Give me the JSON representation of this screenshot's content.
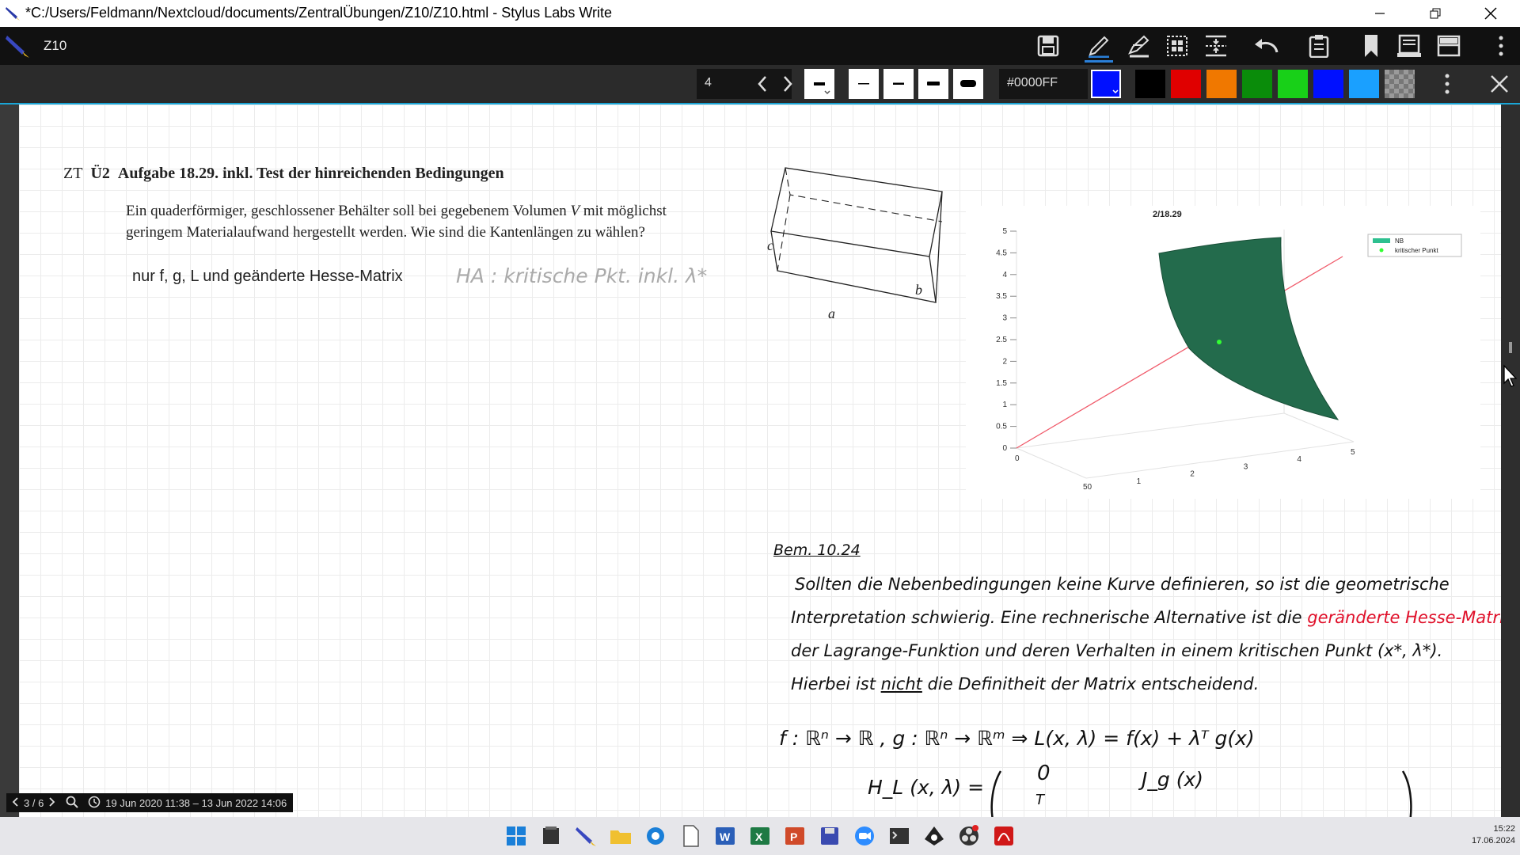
{
  "window": {
    "title": "*C:/Users/Feldmann/Nextcloud/documents/ZentralÜbungen/Z10/Z10.html - Stylus Labs Write"
  },
  "toolbar": {
    "doc_name": "Z10",
    "icons": [
      "save-icon",
      "pen-icon",
      "highlighter-icon",
      "grid-select-icon",
      "insert-space-icon",
      "undo-icon",
      "clipboard-icon",
      "bookmark-icon",
      "page-icon",
      "layout-icon",
      "more-icon"
    ]
  },
  "penbar": {
    "page_value": "4",
    "color_value": "#0000FF",
    "swatches": [
      "#000000",
      "#e00000",
      "#f07800",
      "#0a8c0a",
      "#18d018",
      "#0010ff",
      "#1aa0ff",
      "#9a9a9a"
    ],
    "current_color": "#0000FF"
  },
  "document": {
    "heading_prefix": "ZT",
    "heading_num": "Ü2",
    "heading": "Aufgabe 18.29. inkl. Test der hinreichenden Bedingungen",
    "para_line1_a": "Ein quaderförmiger, geschlossener Behälter soll bei gegebenem Volumen",
    "para_line1_v": "V",
    "para_line1_b": "mit möglichst",
    "para_line2": "geringem Materialaufwand hergestellt werden. Wie sind die Kantenlängen zu wählen?",
    "typed_note": "nur f, g, L und geänderte Hesse-Matrix",
    "ha_note": "HA : kritische Pkt. inkl. λ*",
    "box_labels": {
      "a": "a",
      "b": "b",
      "c": "c"
    },
    "bem_title": "Bem. 10.24",
    "bem_line1": "Sollten die Nebenbedingungen keine Kurve definieren, so ist die geometrische",
    "bem_line2": "Interpretation schwierig. Eine rechnerische Alternative ist die",
    "bem_line2_red": "geränderte Hesse-Matrix",
    "bem_line3": "der Lagrange-Funktion und deren Verhalten in einem kritischen Punkt (x*, λ*).",
    "bem_line4_a": "Hierbei ist",
    "bem_line4_nicht": "nicht",
    "bem_line4_b": "die Definitheit der Matrix entscheidend.",
    "formula1": "f : ℝⁿ → ℝ   ,   g : ℝⁿ → ℝᵐ      ⇒     L(x, λ) = f(x) + λᵀ g(x)",
    "formula2_lhs": "H_L (x, λ) =",
    "formula2_zero": "0",
    "formula2_jg": "J_g (x)",
    "formula2_t": "T"
  },
  "plot": {
    "title": "2/18.29",
    "legend": [
      "NB",
      "kritischer Punkt"
    ],
    "z_ticks": [
      "5",
      "4.5",
      "4",
      "3.5",
      "3",
      "2.5",
      "2",
      "1.5",
      "1",
      "0.5",
      "0"
    ],
    "x_ticks": [
      "1",
      "2",
      "3",
      "4",
      "5"
    ],
    "left_ticks": [
      "0",
      "50"
    ]
  },
  "chart_data": {
    "type": "scatter",
    "title": "2/18.29",
    "series": [
      {
        "name": "NB",
        "values": []
      },
      {
        "name": "kritischer Punkt",
        "values": []
      }
    ],
    "zlim": [
      0,
      5
    ],
    "xlim": [
      0,
      5
    ],
    "grid": true,
    "legend_position": "top-right"
  },
  "status": {
    "page_indicator": "3 / 6",
    "date_range": "19 Jun 2020 11:38 – 13 Jun 2022 14:06"
  },
  "taskbar": {
    "time": "15:22",
    "date": "17.06.2024",
    "apps": [
      "windows-start-icon",
      "file-manager-icon",
      "stylus-write-icon",
      "folder-icon",
      "browser-icon",
      "document-icon",
      "word-icon",
      "excel-icon",
      "powerpoint-icon",
      "floppy-icon",
      "zoom-icon",
      "terminal-icon",
      "inkscape-icon",
      "obs-icon",
      "acrobat-icon"
    ]
  }
}
